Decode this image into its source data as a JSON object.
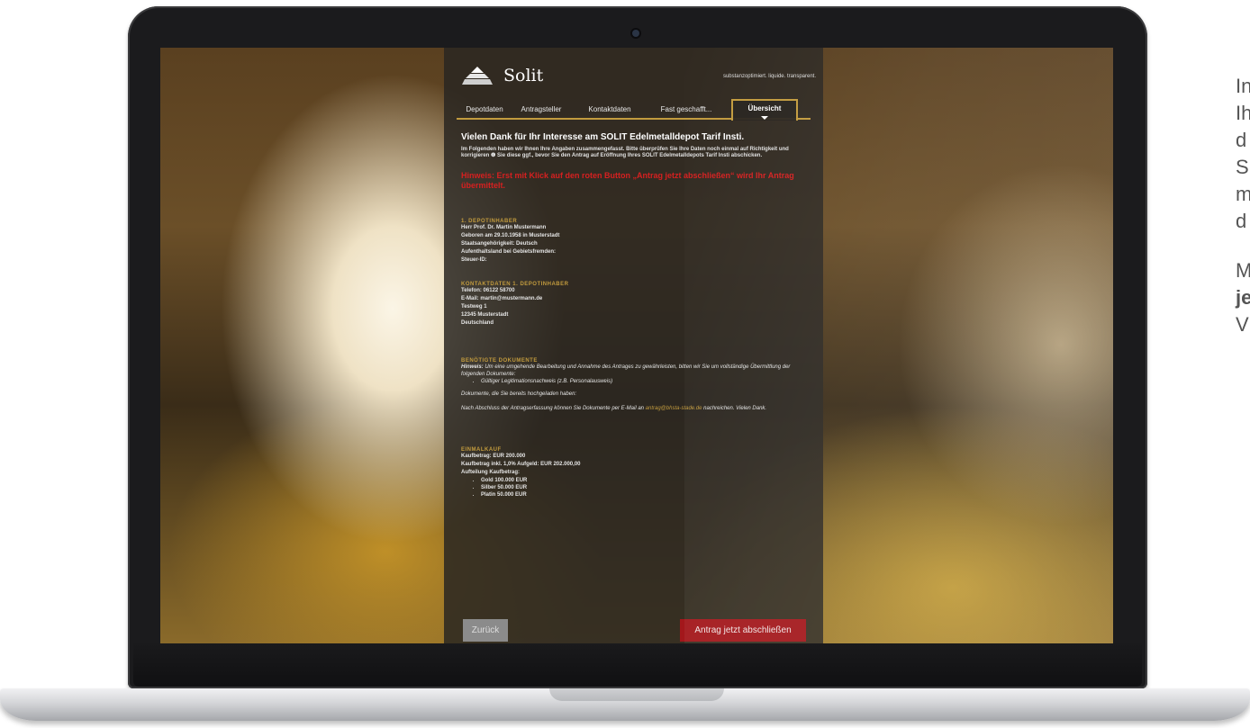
{
  "brand": {
    "name": "Solit",
    "slogan": "substanzoptimiert. liquide. transparent."
  },
  "tabs": [
    {
      "label": "Depotdaten"
    },
    {
      "label": "Antragsteller"
    },
    {
      "label": "Kontaktdaten"
    },
    {
      "label": "Fast geschafft..."
    },
    {
      "label": "Übersicht",
      "active": true
    }
  ],
  "summary": {
    "title": "Vielen Dank für Ihr Interesse am SOLIT Edelmetalldepot Tarif Insti.",
    "intro": "Im Folgenden haben wir Ihnen Ihre Angaben zusammengefasst. Bitte überprüfen Sie Ihre Daten noch einmal auf Richtigkeit und korrigieren ❶ Sie diese ggf., bevor Sie den Antrag auf Eröffnung Ihres SOLIT Edelmetalldepots Tarif Insti abschicken.",
    "warning": "Hinweis: Erst mit Klick auf den roten Button „Antrag jetzt abschließen“ wird Ihr Antrag übermittelt."
  },
  "depot_holder": {
    "heading": "1. DEPOTINHABER",
    "lines": [
      "Herr Prof. Dr. Martin Mustermann",
      "Geboren am 29.10.1958 in Musterstadt",
      "Staatsangehörigkeit: Deutsch",
      "Aufenthaltsland bei Gebietsfremden:",
      "Steuer-ID:"
    ]
  },
  "contact": {
    "heading": "KONTAKTDATEN 1. DEPOTINHABER",
    "lines": [
      "Telefon: 06122 58700",
      "E-Mail: martin@mustermann.de",
      "Testweg 1",
      "12345 Musterstadt",
      "Deutschland"
    ]
  },
  "documents": {
    "heading": "BENÖTIGTE DOKUMENTE",
    "hint_label": "Hinweis:",
    "hint_text": "Um eine umgehende Bearbeitung und Annahme des Antrages zu gewährleisten, bitten wir Sie um vollständige Übermittlung der folgenden Dokumente:",
    "required": [
      "Gültiger Legitimationsnachweis (z.B. Personalausweis)"
    ],
    "uploaded": "Dokumente, die Sie bereits hochgeladen haben:",
    "note_before": "Nach Abschluss der Antragserfassung können Sie Dokumente per E-Mail an",
    "note_email": "antrag@bhsta-stade.de",
    "note_after": "nachreichen. Vielen Dank."
  },
  "purchase": {
    "heading": "EINMALKAUF",
    "amount": "Kaufbetrag: EUR 200.000",
    "amount_incl": "Kaufbetrag inkl. 1,0% Aufgeld: EUR 202.000,00",
    "split_label": "Aufteilung Kaufbetrag:",
    "split": [
      "Gold 100.000 EUR",
      "Silber 50.000 EUR",
      "Platin 50.000 EUR"
    ]
  },
  "buttons": {
    "back": "Zurück",
    "submit": "Antrag jetzt abschließen"
  },
  "side_text": [
    "In",
    "Ih",
    "d",
    "S",
    "m",
    "d",
    "M",
    "je",
    "V"
  ],
  "colors": {
    "accent": "#c29b3e",
    "submit": "#a3171b",
    "warning": "#d62020"
  }
}
